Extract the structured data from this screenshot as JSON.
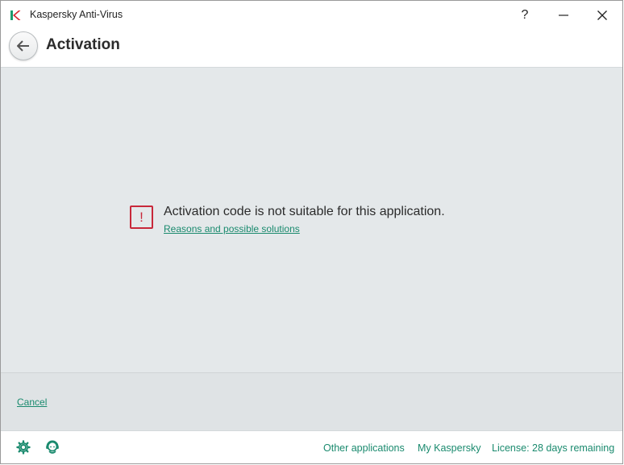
{
  "window": {
    "title": "Kaspersky Anti-Virus",
    "help_glyph": "?",
    "logo_icon": "kaspersky-k-logo"
  },
  "header": {
    "title": "Activation",
    "back_icon": "arrow-left-icon"
  },
  "message": {
    "icon": "error-exclamation-icon",
    "icon_glyph": "!",
    "text": "Activation code is not suitable for this application.",
    "link": "Reasons and possible solutions"
  },
  "actions": {
    "cancel": "Cancel"
  },
  "footer": {
    "settings_icon": "gear-icon",
    "support_icon": "support-icon",
    "other_applications": "Other applications",
    "my_kaspersky": "My Kaspersky",
    "license": "License: 28 days remaining"
  },
  "colors": {
    "accent": "#1a8a6e",
    "error": "#c8283a",
    "main_bg": "#e4e8ea"
  }
}
